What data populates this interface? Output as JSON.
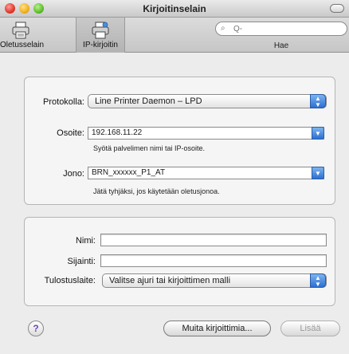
{
  "window": {
    "title": "Kirjoitinselain"
  },
  "toolbar": {
    "default_browser_label": "Oletusselain",
    "ip_printer_label": "IP-kirjoitin",
    "search_placeholder": "Q-",
    "search_label": "Hae"
  },
  "connection": {
    "protocol_label": "Protokolla:",
    "protocol_value": "Line Printer Daemon – LPD",
    "address_label": "Osoite:",
    "address_value": "192.168.11.22",
    "address_hint": "Syötä palvelimen nimi tai IP-osoite.",
    "queue_label": "Jono:",
    "queue_value": "BRN_xxxxxx_P1_AT",
    "queue_hint": "Jätä tyhjäksi, jos käytetään oletusjonoa."
  },
  "details": {
    "name_label": "Nimi:",
    "name_value": "",
    "location_label": "Sijainti:",
    "location_value": "",
    "print_using_label": "Tulostuslaite:",
    "print_using_value": "Valitse ajuri tai kirjoittimen malli"
  },
  "footer": {
    "help_glyph": "?",
    "more_printers_label": "Muita kirjoittimia...",
    "add_label": "Lisää"
  },
  "icons": [
    "printer-icon",
    "printer-network-icon",
    "search-icon",
    "help-icon",
    "popup-arrows-icon"
  ]
}
